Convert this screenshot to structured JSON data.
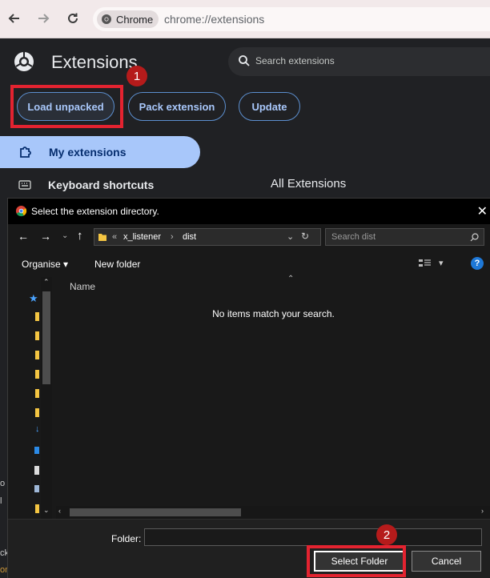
{
  "browser": {
    "chip_label": "Chrome",
    "url": "chrome://extensions"
  },
  "extensions_page": {
    "title": "Extensions",
    "search_placeholder": "Search extensions",
    "buttons": {
      "load_unpacked": "Load unpacked",
      "pack_extension": "Pack extension",
      "update": "Update"
    },
    "sidebar": {
      "my_extensions": "My extensions",
      "keyboard_shortcuts": "Keyboard shortcuts"
    },
    "section_heading": "All Extensions"
  },
  "annotations": {
    "step1": "1",
    "step2": "2",
    "highlight_color": "#e32330"
  },
  "dialog": {
    "title": "Select the extension directory.",
    "breadcrumb": [
      "«",
      "x_listener",
      "›",
      "dist"
    ],
    "search_placeholder": "Search dist",
    "commands": {
      "organise": "Organise",
      "new_folder": "New folder"
    },
    "column_header": "Name",
    "empty_message": "No items match your search.",
    "folder_label": "Folder:",
    "folder_value": "",
    "select_button": "Select Folder",
    "cancel_button": "Cancel"
  },
  "background_edge": {
    "snippet_o": "o",
    "snippet_l": "l",
    "snippet_ck": "ck",
    "snippet_on": "on"
  },
  "colors": {
    "accent_blue": "#a8c7fa",
    "pill_border": "#5c8fcf",
    "page_bg": "#202124",
    "dialog_bg": "#191919",
    "help_blue": "#1e78d7"
  }
}
